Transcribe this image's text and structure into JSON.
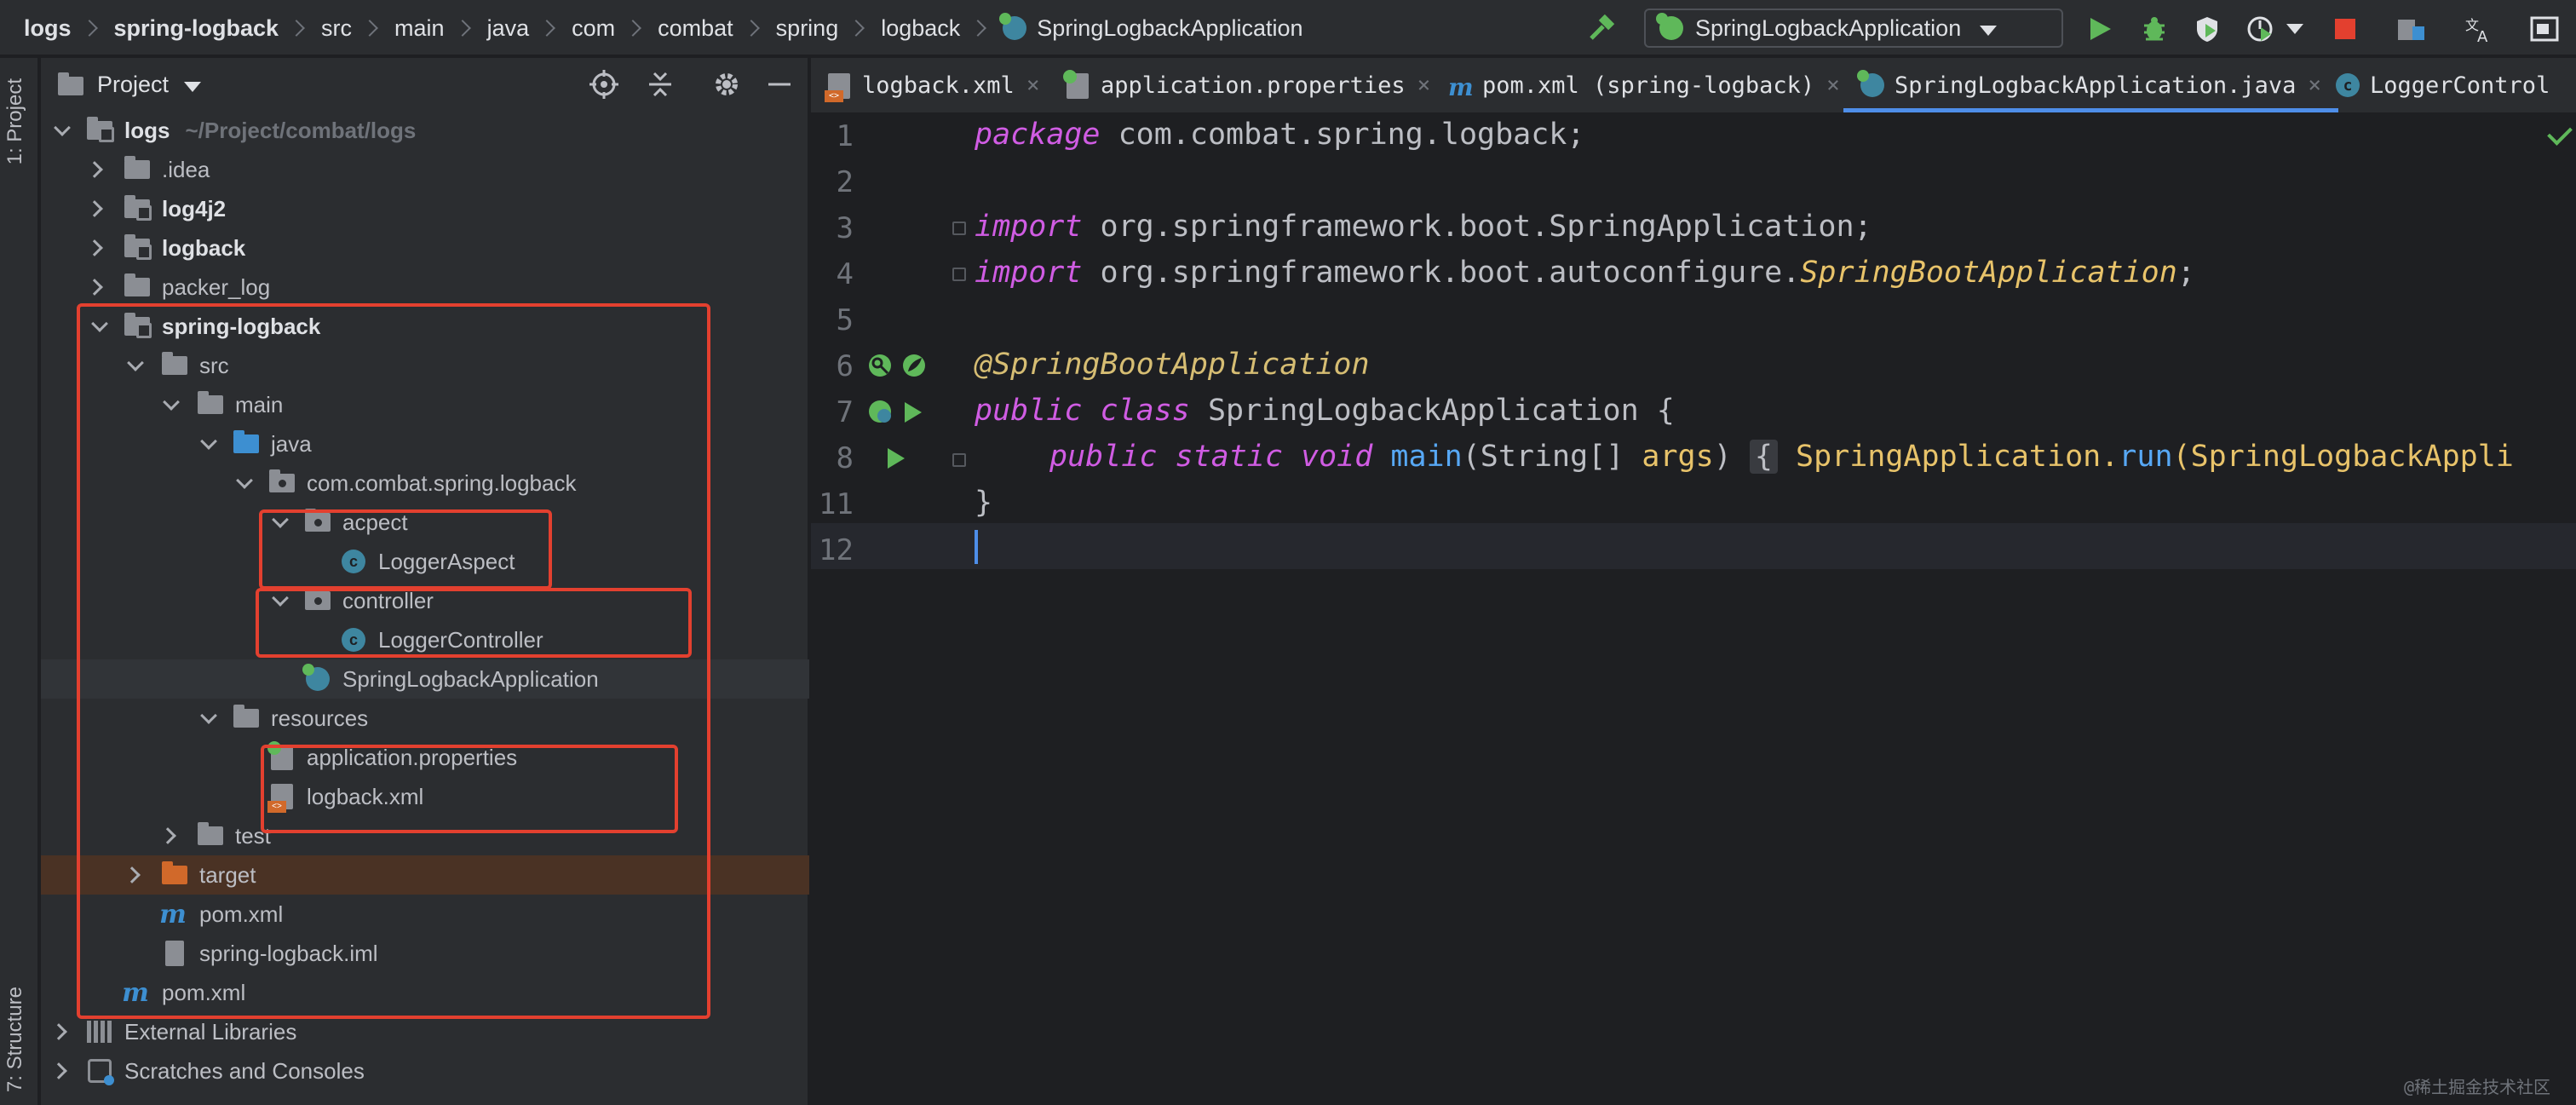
{
  "breadcrumbs": [
    "logs",
    "spring-logback",
    "src",
    "main",
    "java",
    "com",
    "combat",
    "spring",
    "logback",
    "SpringLogbackApplication"
  ],
  "run_config": {
    "label": "SpringLogbackApplication"
  },
  "toolstrip": {
    "project_tab": "1: Project",
    "structure_tab": "7: Structure"
  },
  "project_panel": {
    "title": "Project",
    "tree": [
      {
        "label": "logs",
        "hint": "~/Project/combat/logs",
        "bold": true
      },
      {
        "label": ".idea"
      },
      {
        "label": "log4j2",
        "bold": true
      },
      {
        "label": "logback",
        "bold": true
      },
      {
        "label": "packer_log"
      },
      {
        "label": "spring-logback",
        "bold": true
      },
      {
        "label": "src"
      },
      {
        "label": "main"
      },
      {
        "label": "java"
      },
      {
        "label": "com.combat.spring.logback"
      },
      {
        "label": "acpect"
      },
      {
        "label": "LoggerAspect"
      },
      {
        "label": "controller"
      },
      {
        "label": "LoggerController"
      },
      {
        "label": "SpringLogbackApplication"
      },
      {
        "label": "resources"
      },
      {
        "label": "application.properties"
      },
      {
        "label": "logback.xml"
      },
      {
        "label": "test"
      },
      {
        "label": "target"
      },
      {
        "label": "pom.xml"
      },
      {
        "label": "spring-logback.iml"
      },
      {
        "label": "pom.xml"
      },
      {
        "label": "External Libraries"
      },
      {
        "label": "Scratches and Consoles"
      }
    ]
  },
  "editor_tabs": [
    {
      "label": "logback.xml",
      "close": "×"
    },
    {
      "label": "application.properties",
      "close": "×"
    },
    {
      "label": "pom.xml (spring-logback)",
      "close": "×"
    },
    {
      "label": "SpringLogbackApplication.java",
      "close": "×"
    },
    {
      "label": "LoggerControl"
    }
  ],
  "code": {
    "line_numbers": [
      "1",
      "2",
      "3",
      "4",
      "5",
      "6",
      "7",
      "8",
      "11",
      "12"
    ],
    "package_kw": "package",
    "package_name": " com.combat.spring.logback;",
    "import_kw_1": "import",
    "import_1": " org.springframework.boot.SpringApplication;",
    "import_kw_2": "import",
    "import_2_prefix": " org.springframework.boot.autoconfigure.",
    "import_2_class": "SpringBootApplication",
    "import_2_end": ";",
    "annotation": "@SpringBootApplication",
    "public_kw": "public",
    "class_kw": " class",
    "class_name": " SpringLogbackApplication {",
    "m_public": "public",
    "m_static": " static",
    "m_void": " void",
    "m_name": " main",
    "m_open": "(String[] ",
    "m_param": "args",
    "m_close": ") ",
    "m_brace": "{",
    "m_body_cls": " SpringApplication.",
    "m_body_fn": "run",
    "m_body_rest": "(SpringLogbackAppli",
    "closing": "}"
  },
  "watermark": "@稀土掘金技术社区",
  "colors": {
    "accent": "#4e8ee9",
    "highlight_box": "#e3402f",
    "keyword": "#d05ce3",
    "run_green": "#5fb85a"
  }
}
